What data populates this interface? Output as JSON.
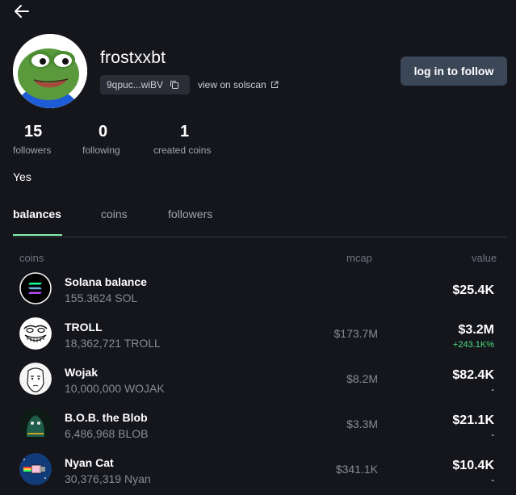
{
  "profile": {
    "username": "frostxxbt",
    "address": "9qpuc...wiBV",
    "solscan_label": "view on solscan",
    "follow_label": "log in to follow",
    "bio": "Yes"
  },
  "stats": [
    {
      "value": "15",
      "label": "followers"
    },
    {
      "value": "0",
      "label": "following"
    },
    {
      "value": "1",
      "label": "created coins"
    }
  ],
  "tabs": [
    {
      "label": "balances",
      "active": true
    },
    {
      "label": "coins",
      "active": false
    },
    {
      "label": "followers",
      "active": false
    }
  ],
  "table": {
    "headers": {
      "coins": "coins",
      "mcap": "mcap",
      "value": "value"
    },
    "rows": [
      {
        "name": "Solana balance",
        "amount": "155.3624 SOL",
        "mcap": "",
        "value": "$25.4K",
        "change": "",
        "icon": "solana-icon"
      },
      {
        "name": "TROLL",
        "amount": "18,362,721 TROLL",
        "mcap": "$173.7M",
        "value": "$3.2M",
        "change": "+243.1K%",
        "icon": "troll-face-icon"
      },
      {
        "name": "Wojak",
        "amount": "10,000,000 WOJAK",
        "mcap": "$8.2M",
        "value": "$82.4K",
        "change": "-",
        "icon": "wojak-icon"
      },
      {
        "name": "B.O.B. the Blob",
        "amount": "6,486,968 BLOB",
        "mcap": "$3.3M",
        "value": "$21.1K",
        "change": "-",
        "icon": "blob-icon"
      },
      {
        "name": "Nyan Cat",
        "amount": "30,376,319 Nyan",
        "mcap": "$341.1K",
        "value": "$10.4K",
        "change": "-",
        "icon": "nyan-cat-icon"
      }
    ]
  },
  "colors": {
    "background": "#15161c",
    "accent": "#86efac",
    "positive": "#4ade80",
    "button": "#3b4757"
  }
}
